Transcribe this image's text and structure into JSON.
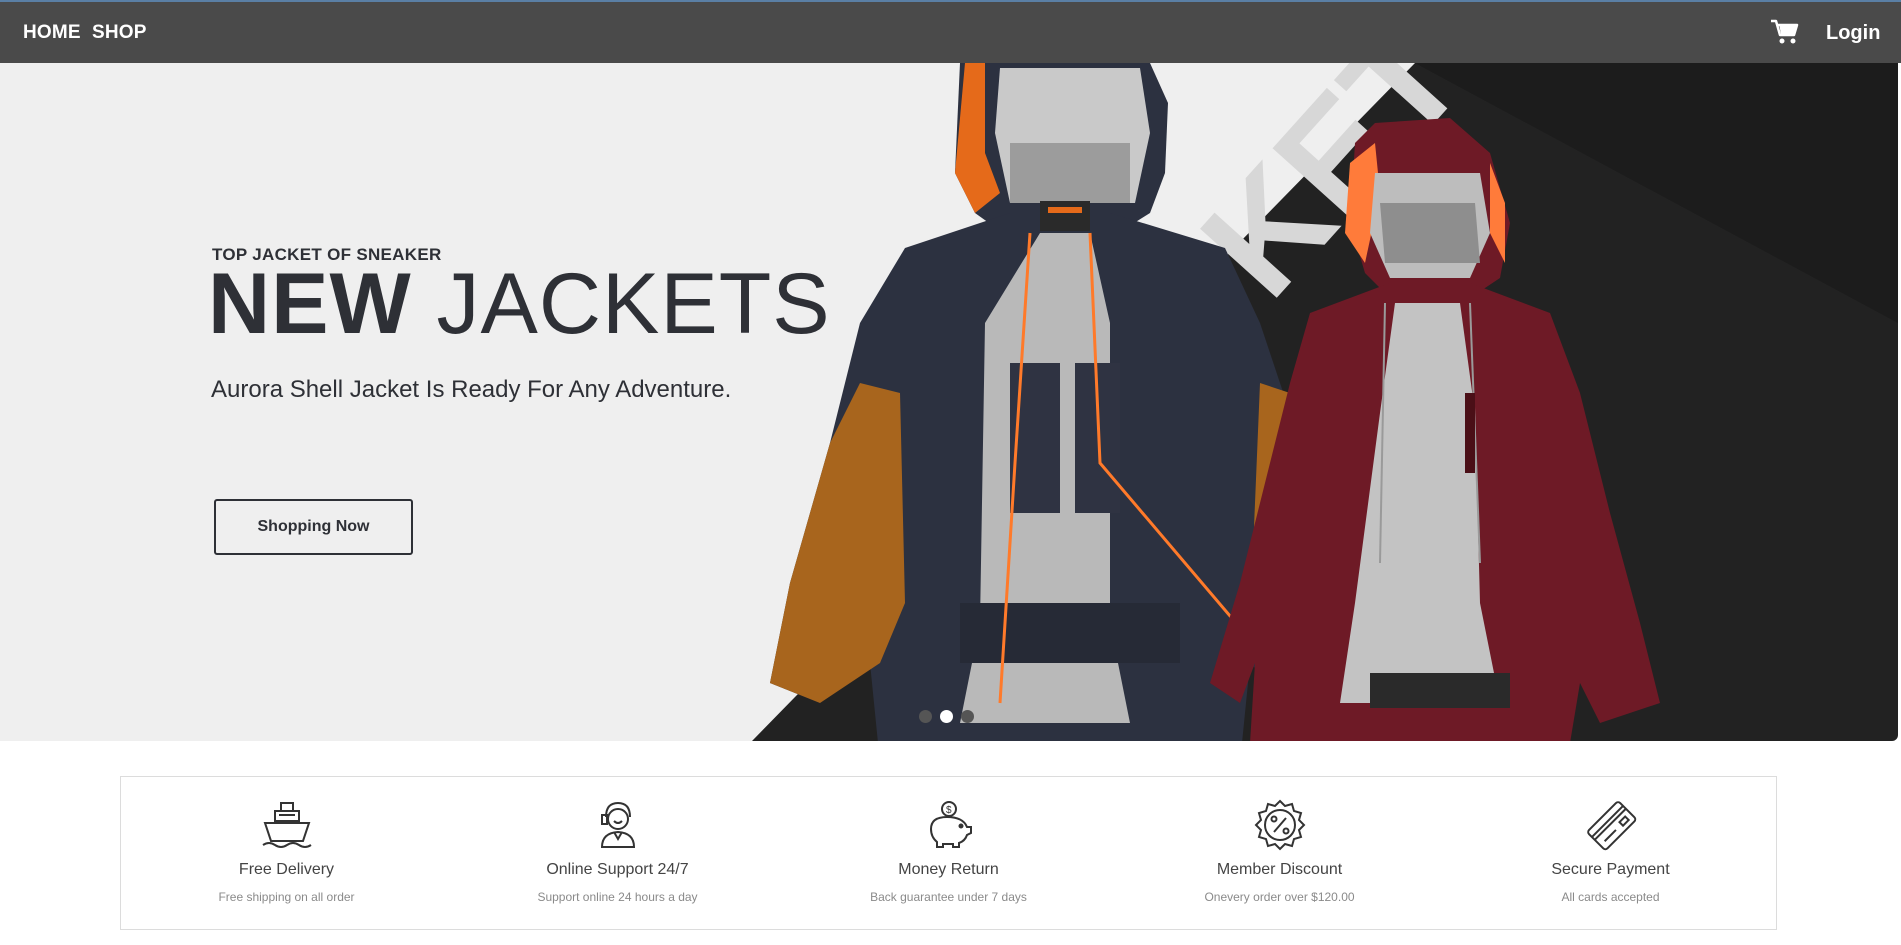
{
  "nav": {
    "home": "HOME",
    "shop": "SHOP",
    "login": "Login"
  },
  "hero": {
    "eyebrow": "TOP JACKET OF SNEAKER",
    "title_bold": "NEW",
    "title_light": "JACKETS",
    "subtitle": "Aurora Shell Jacket Is Ready For Any Adventure.",
    "button": "Shopping Now",
    "slides": 3,
    "active_slide": 2
  },
  "features": [
    {
      "icon": "ship-icon",
      "title": "Free Delivery",
      "desc": "Free shipping on all order"
    },
    {
      "icon": "support-agent-icon",
      "title": "Online Support 24/7",
      "desc": "Support online 24 hours a day"
    },
    {
      "icon": "piggy-bank-icon",
      "title": "Money Return",
      "desc": "Back guarantee under 7 days"
    },
    {
      "icon": "discount-badge-icon",
      "title": "Member Discount",
      "desc": "Onevery order over $120.00"
    },
    {
      "icon": "credit-card-icon",
      "title": "Secure Payment",
      "desc": "All cards accepted"
    }
  ],
  "colors": {
    "nav_bg": "#4a4a4a",
    "hero_bg": "#efefef",
    "text_dark": "#2e3036",
    "jacket_navy": "#2c3140",
    "jacket_orange": "#b06a1e",
    "jacket_maroon": "#6e1a26"
  }
}
